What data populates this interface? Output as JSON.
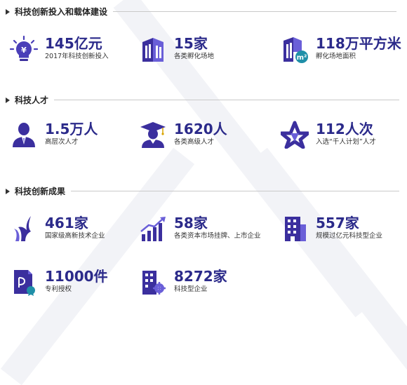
{
  "colors": {
    "primary": "#3b2f9e",
    "accent": "#5a4fd1",
    "value_text": "#2b2a8a"
  },
  "sections": [
    {
      "title": "科技创新投入和载体建设",
      "items": [
        {
          "icon": "lightbulb-yen-icon",
          "value": "145亿元",
          "label": "2017年科技创新投入"
        },
        {
          "icon": "buildings-icon",
          "value": "15家",
          "label": "各类孵化场地"
        },
        {
          "icon": "building-area-icon",
          "value": "118万平方米",
          "label": "孵化场地面积"
        }
      ]
    },
    {
      "title": "科技人才",
      "items": [
        {
          "icon": "person-suit-icon",
          "value": "1.5万人",
          "label": "高层次人才"
        },
        {
          "icon": "graduate-icon",
          "value": "1620人",
          "label": "各类高级人才"
        },
        {
          "icon": "star-emblem-icon",
          "value": "112人次",
          "label": "入选“千人计划”人才"
        }
      ]
    },
    {
      "title": "科技创新成果",
      "items": [
        {
          "icon": "wing-emblem-icon",
          "value": "461家",
          "label": "国家级高新技术企业"
        },
        {
          "icon": "growth-chart-icon",
          "value": "58家",
          "label": "各类资本市场挂牌、上市企业"
        },
        {
          "icon": "office-building-icon",
          "value": "557家",
          "label": "规模过亿元科技型企业"
        },
        {
          "icon": "patent-certificate-icon",
          "value": "11000件",
          "label": "专利授权"
        },
        {
          "icon": "tech-company-icon",
          "value": "8272家",
          "label": "科技型企业"
        }
      ]
    }
  ]
}
